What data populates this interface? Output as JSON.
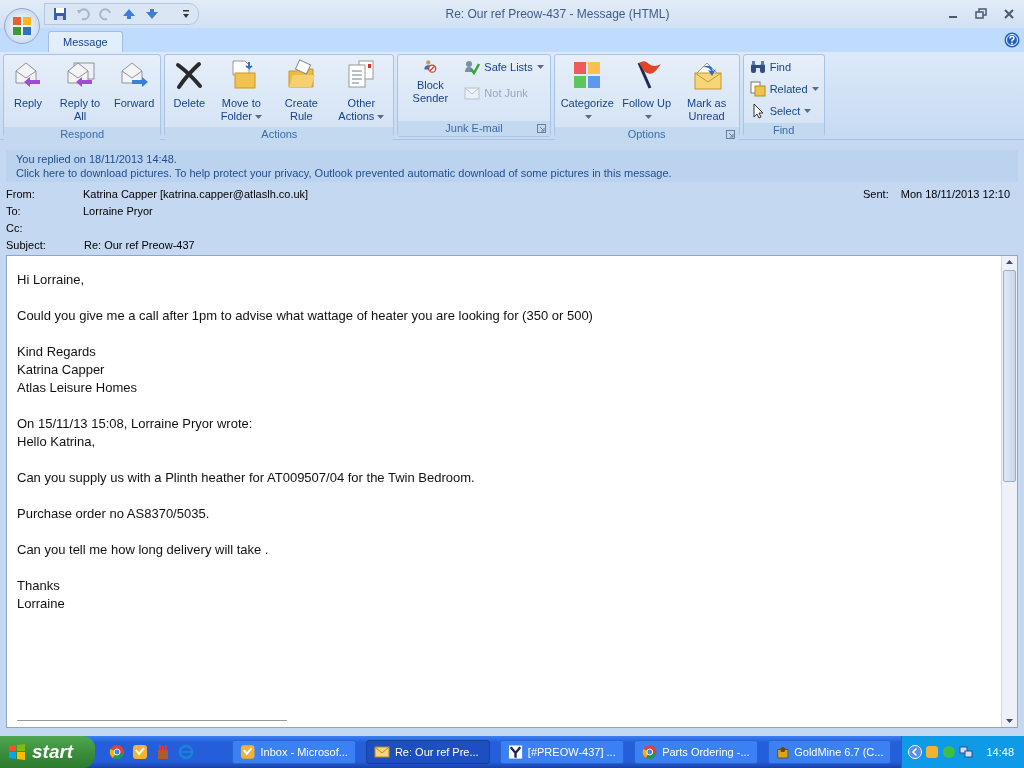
{
  "window": {
    "title": "Re: Our ref Preow-437  - Message (HTML)"
  },
  "tabs": [
    {
      "label": "Message",
      "selected": true
    }
  ],
  "ribbon": {
    "groups": [
      {
        "label": "Respond",
        "dialog": false,
        "buttons": [
          {
            "kind": "large",
            "label": "Reply",
            "dropdown": false,
            "disabled": false
          },
          {
            "kind": "large",
            "label": "Reply to All",
            "dropdown": false,
            "disabled": false
          },
          {
            "kind": "large",
            "label": "Forward",
            "dropdown": false,
            "disabled": false
          }
        ]
      },
      {
        "label": "Actions",
        "dialog": false,
        "buttons": [
          {
            "kind": "large",
            "label": "Delete",
            "dropdown": false,
            "disabled": false
          },
          {
            "kind": "large",
            "label": "Move to Folder",
            "dropdown": true,
            "disabled": false
          },
          {
            "kind": "large",
            "label": "Create Rule",
            "dropdown": false,
            "disabled": false
          },
          {
            "kind": "large",
            "label": "Other Actions",
            "dropdown": true,
            "disabled": false
          }
        ]
      },
      {
        "label": "Junk E-mail",
        "dialog": true,
        "buttons": [
          {
            "kind": "large",
            "label": "Block Sender",
            "dropdown": false,
            "disabled": false
          },
          {
            "kind": "small",
            "label": "Safe Lists",
            "dropdown": true,
            "disabled": false
          },
          {
            "kind": "small",
            "label": "Not Junk",
            "dropdown": false,
            "disabled": true
          }
        ]
      },
      {
        "label": "Options",
        "dialog": true,
        "buttons": [
          {
            "kind": "large",
            "label": "Categorize",
            "dropdown": true,
            "disabled": false
          },
          {
            "kind": "large",
            "label": "Follow Up",
            "dropdown": true,
            "disabled": false
          },
          {
            "kind": "large",
            "label": "Mark as Unread",
            "dropdown": false,
            "disabled": false
          }
        ]
      },
      {
        "label": "Find",
        "dialog": false,
        "buttons": [
          {
            "kind": "small",
            "label": "Find",
            "dropdown": false,
            "disabled": false
          },
          {
            "kind": "small",
            "label": "Related",
            "dropdown": true,
            "disabled": false
          },
          {
            "kind": "small",
            "label": "Select",
            "dropdown": true,
            "disabled": false
          }
        ]
      }
    ]
  },
  "infobar": [
    "You replied on 18/11/2013 14:48.",
    "Click here to download pictures. To help protect your privacy, Outlook prevented automatic download of some pictures in this message."
  ],
  "header": {
    "fields": [
      {
        "label": "From:",
        "value": "Katrina Capper [katrina.capper@atlaslh.co.uk]"
      },
      {
        "label": "To:",
        "value": "Lorraine Pryor"
      },
      {
        "label": "Cc:"
      },
      {
        "label": "Subject:",
        "value": "Re: Our ref Preow-437"
      }
    ],
    "sent_label": "Sent:",
    "sent": "Mon 18/11/2013 12:10"
  },
  "body": [
    [
      "Hi Lorraine,"
    ],
    [
      "Could you give me a call after 1pm to advise what wattage of heater you are looking for (350 or 500)"
    ],
    [
      "Kind Regards",
      "Katrina Capper",
      "Atlas Leisure Homes"
    ],
    [
      "On 15/11/13 15:08, Lorraine Pryor wrote:",
      "Hello Katrina,"
    ],
    [
      "Can you supply us with a Plinth heather for AT009507/04 for the Twin Bedroom."
    ],
    [
      "Purchase order no AS8370/5035."
    ],
    [
      "Can you tell me how long delivery will take ."
    ],
    [
      "Thanks",
      "Lorraine"
    ]
  ],
  "taskbar": {
    "start": "start",
    "tasks": [
      {
        "label": "Inbox - Microsof...",
        "selected": false
      },
      {
        "label": "Re: Our ref Pre...",
        "selected": true
      },
      {
        "label": "[#PREOW-437] ...",
        "selected": false
      },
      {
        "label": "Parts Ordering -...",
        "selected": false
      },
      {
        "label": "GoldMine 6.7 (C...",
        "selected": false
      }
    ],
    "clock": "14:48"
  }
}
